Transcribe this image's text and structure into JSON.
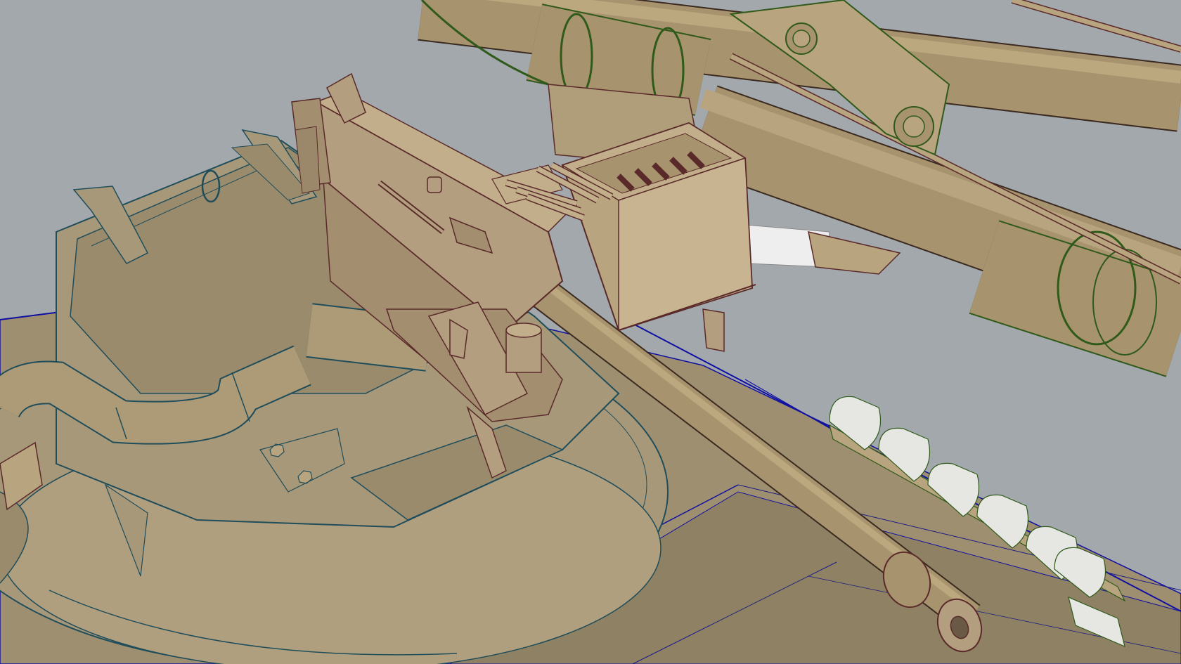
{
  "viewport": {
    "mode": "3d-cad-shaded-with-edges",
    "colors": {
      "background": "#a3a8ad",
      "hull_fill": "#9e8f71",
      "turret_fill": "#a8987a",
      "machine_gun_fill": "#b39f7f",
      "part_fill": "#b8a47f",
      "barrel_fill": "#a8936f",
      "edge_teal": "#1f4d5a",
      "edge_brown": "#5a2a2a",
      "edge_green": "#2f5a1a",
      "edge_blue": "#1010a0",
      "grip_fill": "#e6e6e2"
    }
  }
}
